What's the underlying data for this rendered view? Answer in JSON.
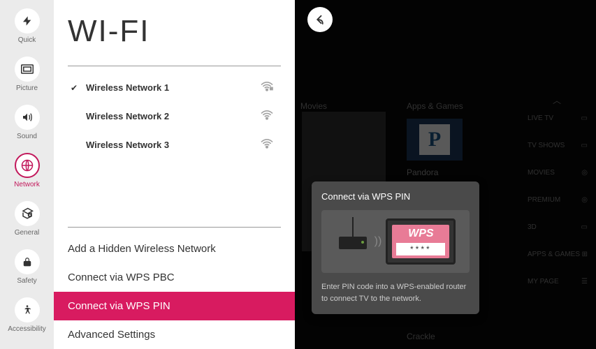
{
  "sidebar": {
    "items": [
      {
        "label": "Quick",
        "icon": "bolt"
      },
      {
        "label": "Picture",
        "icon": "picture"
      },
      {
        "label": "Sound",
        "icon": "sound"
      },
      {
        "label": "Network",
        "icon": "network",
        "active": true
      },
      {
        "label": "General",
        "icon": "general"
      },
      {
        "label": "Safety",
        "icon": "lock"
      },
      {
        "label": "Accessibility",
        "icon": "accessibility"
      }
    ]
  },
  "panel": {
    "title": "WI-FI",
    "networks": [
      {
        "name": "Wireless Network 1",
        "connected": true,
        "secured": true
      },
      {
        "name": "Wireless Network 2",
        "connected": false,
        "secured": false
      },
      {
        "name": "Wireless Network 3",
        "connected": false,
        "secured": false
      }
    ],
    "options": [
      {
        "label": "Add a Hidden Wireless Network"
      },
      {
        "label": "Connect via WPS PBC"
      },
      {
        "label": "Connect via WPS PIN",
        "selected": true
      },
      {
        "label": "Advanced Settings"
      }
    ]
  },
  "background": {
    "section1": "Movies",
    "section2": "Apps & Games",
    "pandora": "Pandora",
    "crackle": "Crackle",
    "rightMenu": [
      "LIVE TV",
      "TV SHOWS",
      "MOVIES",
      "PREMIUM",
      "3D",
      "APPS & GAMES",
      "MY PAGE"
    ]
  },
  "tooltip": {
    "title": "Connect via WPS PIN",
    "wps": "WPS",
    "pin": "****",
    "text": "Enter PIN code into a WPS-enabled router to connect TV to the network."
  }
}
